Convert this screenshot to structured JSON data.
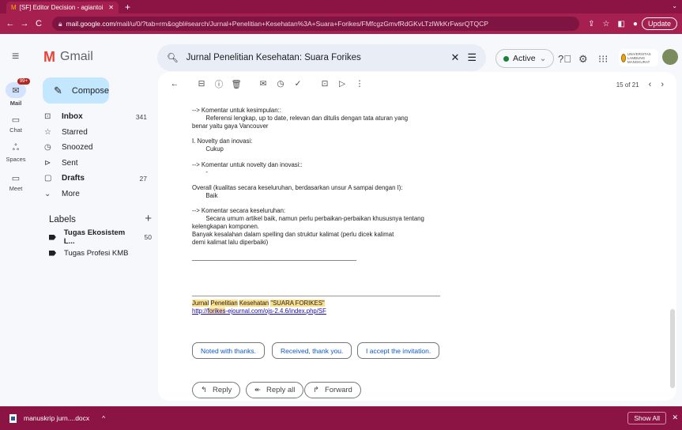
{
  "browser": {
    "tab_title": "[SF] Editor Decision - agiantoi",
    "new_tab": "+",
    "url_host": "mail.google.com",
    "url_path": "/mail/u/0/?tab=rm&ogbl#search/Jurnal+Penelitian+Kesehatan%3A+Suara+Forikes/FMfcgzGmvfRdGKvLTzlWkKrFwsrQTQCP",
    "update_label": "Update"
  },
  "gmail": {
    "logo_text": "Gmail",
    "search_query": "Jurnal Penelitian Kesehatan: Suara Forikes",
    "status": "Active",
    "university_badge": "UNIVERSITAS LAMBUNG MANGKURAT"
  },
  "rail": [
    {
      "label": "Mail",
      "badge": "99+"
    },
    {
      "label": "Chat"
    },
    {
      "label": "Spaces"
    },
    {
      "label": "Meet"
    }
  ],
  "compose_label": "Compose",
  "folders": [
    {
      "label": "Inbox",
      "count": "341",
      "icon": "inbox-icon",
      "glyph": "⊡",
      "bold": true
    },
    {
      "label": "Starred",
      "count": "",
      "icon": "star-icon",
      "glyph": "☆",
      "bold": false
    },
    {
      "label": "Snoozed",
      "count": "",
      "icon": "clock-icon",
      "glyph": "◷",
      "bold": false
    },
    {
      "label": "Sent",
      "count": "",
      "icon": "send-icon",
      "glyph": "⊳",
      "bold": false
    },
    {
      "label": "Drafts",
      "count": "27",
      "icon": "draft-icon",
      "glyph": "▢",
      "bold": true
    },
    {
      "label": "More",
      "count": "",
      "icon": "chevron-down-icon",
      "glyph": "⌄",
      "bold": false
    }
  ],
  "labels_title": "Labels",
  "labels": [
    {
      "label": "Tugas Ekosistem L...",
      "count": "50",
      "bold": true
    },
    {
      "label": "Tugas Profesi KMB",
      "count": "",
      "bold": false
    }
  ],
  "pager": {
    "text": "15 of 21"
  },
  "message": {
    "lines": [
      "--> Komentar untuk kesimpulan::",
      "        Referensi lengkap, up to date, relevan dan ditulis dengan tata aturan yang",
      "benar yaitu gaya Vancouver",
      "",
      "I. Novelty dan inovasi:",
      "        Cukup",
      "",
      "--> Komentar untuk novelty dan inovasi::",
      "        -",
      "",
      "Overall (kualitas secara keseluruhan, berdasarkan unsur A sampai dengan I):",
      "        Baik",
      "",
      "--> Komentar secara keseluruhan:",
      "        Secara umum artikel baik, namun perlu perbaikan-perbaikan khususnya tentang",
      "kelengkapan komponen.",
      "Banyak kesalahan dalam spelling dan struktur kalimat (perlu dicek kalimat",
      "demi kalimat lalu diperbaiki)",
      "",
      "________________________________________________"
    ],
    "signature_journal_1": "Jurnal",
    "signature_journal_2": "Penelitian",
    "signature_journal_3": "Kesehatan",
    "signature_journal_4": "\"SUARA FORIKES\"",
    "link_prefix": "http://",
    "link_highlight": "forikes",
    "link_suffix": "-ejournal.com/ojs-2.4.6/index.php/SF"
  },
  "smart_replies": [
    "Noted with thanks.",
    "Received, thank you.",
    "I accept the invitation."
  ],
  "actions": [
    {
      "label": "Reply",
      "glyph": "↰"
    },
    {
      "label": "Reply all",
      "glyph": "↞"
    },
    {
      "label": "Forward",
      "glyph": "↱"
    }
  ],
  "download": {
    "file": "manuskrip jurn....docx",
    "show_all": "Show All"
  }
}
